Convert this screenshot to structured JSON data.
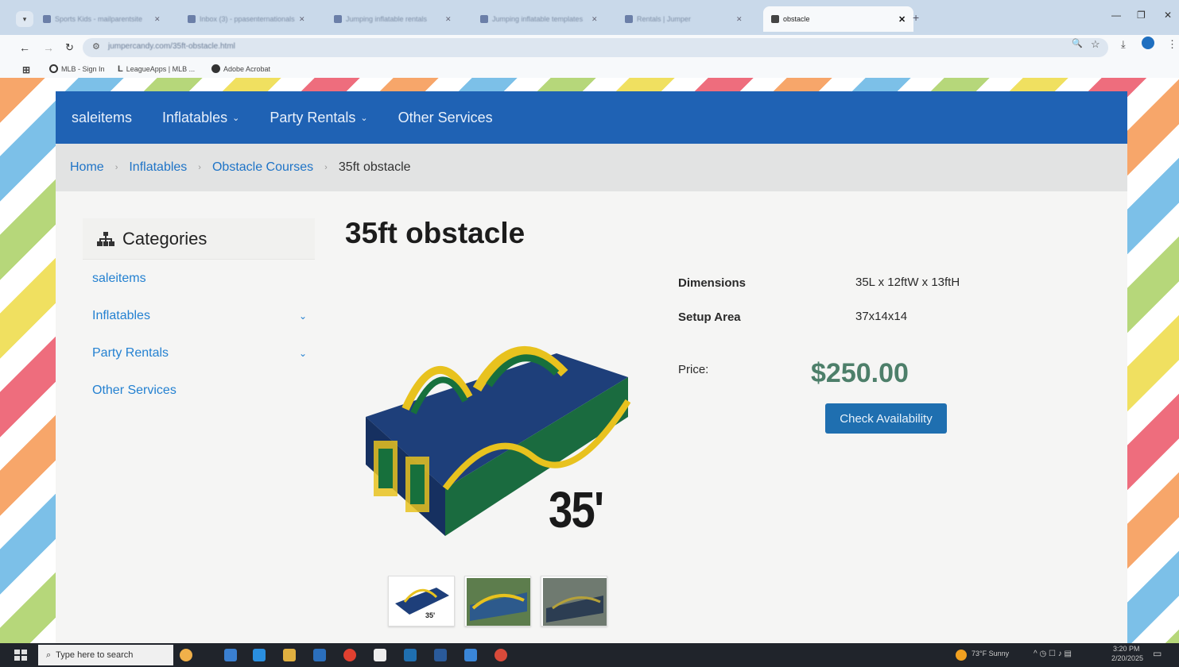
{
  "browser": {
    "tabs": [
      {
        "title": "Sports Kids - mailparentsite",
        "active": false
      },
      {
        "title": "Inbox (3) - ppasenternationals",
        "active": false
      },
      {
        "title": "Jumping inflatable rentals",
        "active": false
      },
      {
        "title": "Jumping inflatable templates",
        "active": false
      },
      {
        "title": "Rentals | Jumper",
        "active": false
      },
      {
        "title": "obstacle",
        "active": true
      }
    ],
    "url": "jumpercandy.com/35ft-obstacle.html",
    "bookmarks": [
      "MLB - Sign In",
      "LeagueApps | MLB ...",
      "Adobe Acrobat"
    ]
  },
  "nav": {
    "items": [
      {
        "label": "saleitems",
        "has_dropdown": false
      },
      {
        "label": "Inflatables",
        "has_dropdown": true
      },
      {
        "label": "Party Rentals",
        "has_dropdown": true
      },
      {
        "label": "Other Services",
        "has_dropdown": false
      }
    ]
  },
  "breadcrumb": {
    "home": "Home",
    "level1": "Inflatables",
    "level2": "Obstacle Courses",
    "current": "35ft obstacle"
  },
  "sidebar": {
    "title": "Categories",
    "items": [
      {
        "label": "saleitems",
        "has_dropdown": false
      },
      {
        "label": "Inflatables",
        "has_dropdown": true
      },
      {
        "label": "Party Rentals",
        "has_dropdown": true
      },
      {
        "label": "Other Services",
        "has_dropdown": false
      }
    ]
  },
  "product": {
    "title": "35ft obstacle",
    "image_caption": "35'",
    "thumb_caption": "35'",
    "dimensions_label": "Dimensions",
    "dimensions_value": "35L x 12ftW x 13ftH",
    "setup_label": "Setup Area",
    "setup_value": "37x14x14",
    "price_label": "Price:",
    "price_value": "$250.00",
    "cta": "Check Availability"
  },
  "taskbar": {
    "search_placeholder": "Type here to search",
    "weather": "73°F  Sunny",
    "time": "3:20 PM",
    "date": "2/20/2025"
  },
  "colors": {
    "nav_bg": "#1f62b4",
    "link": "#1f74c7",
    "price": "#4d7f6a",
    "button": "#1f6fb0"
  }
}
